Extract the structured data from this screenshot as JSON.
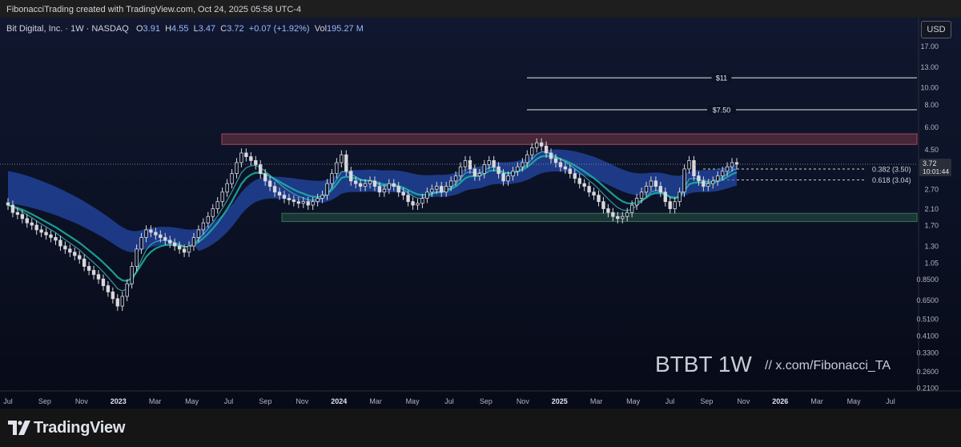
{
  "header": {
    "text": "FibonacciTrading created with TradingView.com, Oct 24, 2025 05:58 UTC-4"
  },
  "legend": {
    "symbol": "Bit Digital, Inc. · 1W · NASDAQ",
    "o_label": "O",
    "o_value": "3.91",
    "h_label": "H",
    "h_value": "4.55",
    "l_label": "L",
    "l_value": "3.47",
    "c_label": "C",
    "c_value": "3.72",
    "change": "+0.07 (+1.92%)",
    "vol_label": "Vol",
    "vol_value": "195.27 M"
  },
  "currency_button": "USD",
  "footer": {
    "brand": "TradingView"
  },
  "watermark": {
    "ticker": "BTBT 1W",
    "handle": "//  x.com/Fibonacci_TA"
  },
  "colors": {
    "background_top": "#10172e",
    "background_bottom": "#070a17",
    "ribbon": "#2a55c6",
    "ema_teal": "#1db5a6",
    "resistance_zone": "#b24a5a",
    "support_zone": "#3a7a5a",
    "candle_up": "#d8d8dc",
    "candle_down": "#d8d8dc"
  },
  "chart_data": {
    "type": "candlestick",
    "symbol": "BTBT",
    "timeframe": "1W",
    "scale": "log",
    "ylim": [
      0.21,
      18
    ],
    "y_ticks": [
      "17.00",
      "13.00",
      "10.00",
      "8.00",
      "6.00",
      "4.50",
      "3.40",
      "2.70",
      "2.10",
      "1.70",
      "1.30",
      "1.05",
      "0.8500",
      "0.6500",
      "0.5100",
      "0.4100",
      "0.3300",
      "0.2600",
      "0.2100"
    ],
    "x_ticks": [
      "Jul",
      "Sep",
      "Nov",
      "2023",
      "Mar",
      "May",
      "Jul",
      "Sep",
      "Nov",
      "2024",
      "Mar",
      "May",
      "Jul",
      "Sep",
      "Nov",
      "2025",
      "Mar",
      "May",
      "Jul",
      "Sep",
      "Nov",
      "2026",
      "Mar",
      "May",
      "Jul"
    ],
    "x_tick_bold": [
      "2023",
      "2024",
      "2025",
      "2026"
    ],
    "price_targets": [
      {
        "label": "$11",
        "value": 11.3
      },
      {
        "label": "$7.50",
        "value": 7.5
      }
    ],
    "fib_levels": [
      {
        "label": "0.382 (3.50)",
        "value": 3.5
      },
      {
        "label": "0.618 (3.04)",
        "value": 3.04
      }
    ],
    "zones": [
      {
        "name": "resistance",
        "low": 4.8,
        "high": 5.5
      },
      {
        "name": "support",
        "low": 1.78,
        "high": 1.98
      }
    ],
    "last_price": {
      "value": "3.72",
      "countdown": "10:01:44"
    },
    "closes": [
      2.2,
      2.0,
      1.95,
      1.85,
      1.75,
      1.7,
      1.6,
      1.55,
      1.5,
      1.45,
      1.4,
      1.3,
      1.25,
      1.2,
      1.15,
      1.1,
      1.0,
      0.95,
      0.9,
      0.85,
      0.78,
      0.72,
      0.66,
      0.6,
      0.68,
      0.8,
      1.0,
      1.25,
      1.45,
      1.6,
      1.55,
      1.5,
      1.45,
      1.4,
      1.35,
      1.3,
      1.25,
      1.2,
      1.3,
      1.45,
      1.6,
      1.75,
      1.9,
      2.1,
      2.3,
      2.6,
      2.9,
      3.3,
      3.8,
      4.3,
      4.1,
      3.9,
      3.7,
      3.3,
      3.0,
      2.8,
      2.6,
      2.5,
      2.4,
      2.35,
      2.3,
      2.25,
      2.3,
      2.2,
      2.3,
      2.4,
      2.5,
      2.9,
      3.3,
      3.8,
      4.2,
      3.4,
      3.0,
      2.9,
      2.8,
      2.9,
      3.0,
      2.8,
      2.6,
      2.7,
      2.9,
      2.8,
      2.6,
      2.5,
      2.3,
      2.2,
      2.25,
      2.4,
      2.6,
      2.7,
      2.8,
      2.6,
      2.8,
      3.0,
      3.2,
      3.6,
      3.9,
      3.5,
      3.2,
      3.3,
      3.7,
      3.9,
      3.6,
      3.3,
      3.0,
      3.2,
      3.4,
      3.6,
      3.8,
      4.2,
      4.6,
      4.9,
      4.7,
      4.3,
      4.0,
      3.8,
      3.6,
      3.5,
      3.3,
      3.1,
      2.9,
      2.8,
      2.6,
      2.5,
      2.3,
      2.1,
      2.0,
      1.9,
      1.85,
      1.9,
      2.0,
      2.2,
      2.4,
      2.6,
      2.8,
      3.0,
      2.8,
      2.6,
      2.3,
      2.1,
      2.3,
      2.6,
      3.5,
      3.9,
      3.2,
      3.0,
      2.8,
      2.9,
      3.0,
      3.2,
      3.4,
      3.6,
      3.8,
      3.72
    ]
  }
}
